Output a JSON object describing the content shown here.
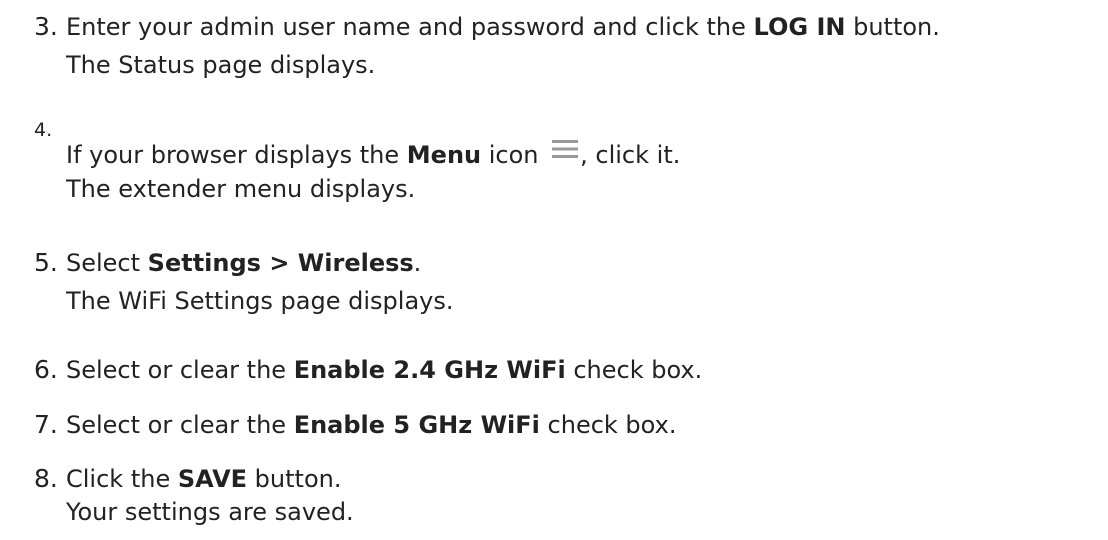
{
  "steps": [
    {
      "number": "3.",
      "parts": {
        "a": "Enter your admin user name and password and click the ",
        "b": "LOG IN",
        "c": " button."
      },
      "result": "The Status page displays."
    },
    {
      "number": "4.",
      "parts": {
        "a": "If your browser displays the ",
        "b": "Menu",
        "c": " icon ",
        "icon": "menu-icon",
        "d": ", click it."
      },
      "result": "The extender menu displays."
    },
    {
      "number": "5.",
      "parts": {
        "a": "Select ",
        "b": "Settings > Wireless",
        "c": "."
      },
      "result": "The WiFi Settings page displays."
    },
    {
      "number": "6.",
      "parts": {
        "a": "Select or clear the ",
        "b": "Enable 2.4 GHz WiFi",
        "c": " check box."
      }
    },
    {
      "number": "7.",
      "parts": {
        "a": "Select or clear the ",
        "b": "Enable 5 GHz WiFi",
        "c": " check box."
      }
    },
    {
      "number": "8.",
      "parts": {
        "a": "Click the ",
        "b": "SAVE",
        "c": " button."
      },
      "result": "Your settings are saved."
    }
  ],
  "colors": {
    "text": "#222222",
    "icon": "#9a9a9a",
    "background": "#ffffff"
  }
}
